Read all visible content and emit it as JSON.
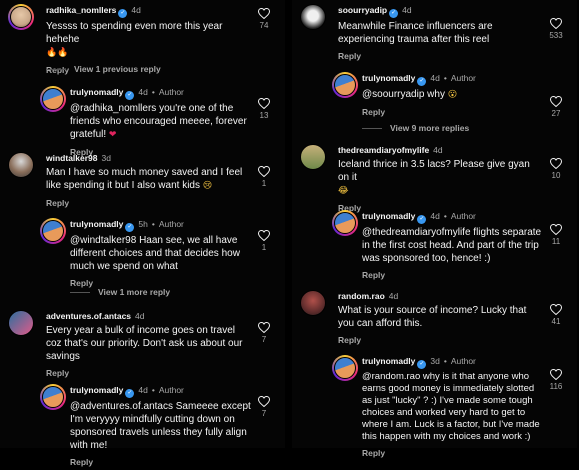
{
  "left": {
    "c1": {
      "user": "radhika_nomllers",
      "verified": true,
      "time": "4d",
      "text": "Yessss to spending even more this year hehehe",
      "emoji": "🔥🔥",
      "reply": "Reply",
      "likes": "74",
      "colors": [
        "#c9a789",
        "#e6c8a8"
      ]
    },
    "more1": "View 1 previous reply",
    "r1": {
      "user": "trulynomadly",
      "verified": true,
      "time": "4d",
      "author": "Author",
      "text": "@radhika_nomllers you're one of the friends who encouraged meeee, forever grateful!",
      "emoji": "❤",
      "reply": "Reply",
      "likes": "13"
    },
    "c2": {
      "user": "windtalker98",
      "verified": false,
      "time": "3d",
      "text": "Man I have so much money saved and I feel like spending it but I also want kids",
      "emoji": "😢",
      "reply": "Reply",
      "likes": "1",
      "colors": [
        "#8a6e5a",
        "#d8d8d8"
      ]
    },
    "r2": {
      "user": "trulynomadly",
      "verified": true,
      "time": "5h",
      "author": "Author",
      "text": "@windtalker98 Haan see, we all have different choices and that decides how much we spend on what",
      "reply": "Reply",
      "likes": "1"
    },
    "more2": "View 1 more reply",
    "c3": {
      "user": "adventures.of.antacs",
      "verified": false,
      "time": "4d",
      "text": "Every year a bulk of income goes on travel coz that's our priority. Don't ask us about our savings",
      "reply": "Reply",
      "likes": "7",
      "colors": [
        "#2b6f9e",
        "#e05b8a"
      ]
    },
    "r3": {
      "user": "trulynomadly",
      "verified": true,
      "time": "4d",
      "author": "Author",
      "text": "@adventures.of.antacs Sameeee except I'm veryyyy mindfully cutting down on sponsored travels unless they fully align with me!",
      "reply": "Reply",
      "likes": "7"
    }
  },
  "right": {
    "c1": {
      "user": "soourryadip",
      "verified": true,
      "time": "4d",
      "text": "Meanwhile Finance influencers are experiencing trauma after this reel",
      "reply": "Reply",
      "likes": "533",
      "colors": [
        "#f0f0f0",
        "#222222"
      ]
    },
    "r1": {
      "user": "trulynomadly",
      "verified": true,
      "time": "4d",
      "author": "Author",
      "text": "@soourryadip why",
      "emoji": "😮",
      "reply": "Reply",
      "likes": "27"
    },
    "more1": "View 9 more replies",
    "c2": {
      "user": "thedreamdiaryofmylife",
      "verified": false,
      "time": "4d",
      "text": "Iceland thrice in 3.5 lacs? Please give gyan on it",
      "emoji": "😂",
      "reply": "Reply",
      "likes": "10",
      "colors": [
        "#6f8a4a",
        "#c6b07a"
      ]
    },
    "r2": {
      "user": "trulynomadly",
      "verified": true,
      "time": "4d",
      "author": "Author",
      "text": "@thedreamdiaryofmylife flights separate in the first cost head. And part of the trip was sponsored too, hence! :)",
      "reply": "Reply",
      "likes": "11"
    },
    "c3": {
      "user": "random.rao",
      "verified": false,
      "time": "4d",
      "text": "What is your source of income? Lucky that you can afford this.",
      "reply": "Reply",
      "likes": "41",
      "colors": [
        "#5a2a2a",
        "#b0504a"
      ]
    },
    "r3": {
      "user": "trulynomadly",
      "verified": true,
      "time": "3d",
      "author": "Author",
      "text": "@random.rao why is it that anyone who earns good money is immediately slotted as just \"lucky\" ? :) I've made some tough choices and worked very hard to get to where I am. Luck is a factor, but I've made this happen with my choices and work :)",
      "reply": "Reply",
      "likes": "116"
    }
  },
  "author_avatar_colors": [
    "#3f7fd0",
    "#e89a5a"
  ],
  "badge_glyph": "✓",
  "author_sep": "•",
  "colors": {
    "background": "#000000",
    "text": "#f5f5f5",
    "muted": "#a8a8a8",
    "verified": "#3897f0"
  }
}
